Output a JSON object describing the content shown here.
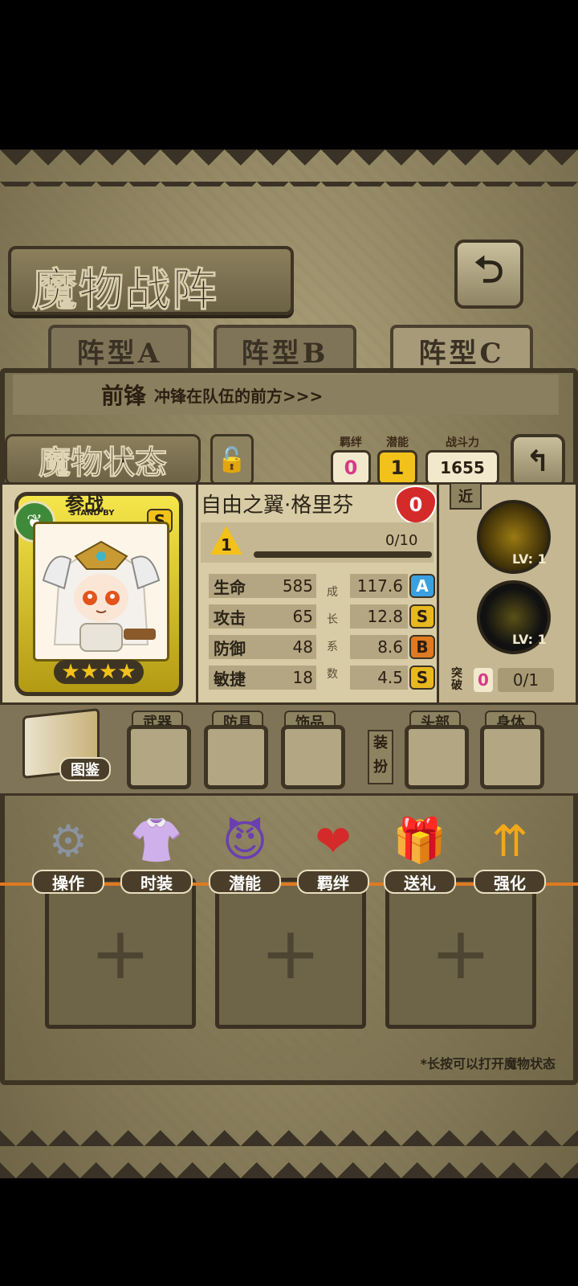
{
  "formation": {
    "title": "魔物战阵",
    "tabs": [
      "阵型A",
      "阵型B",
      "阵型C"
    ],
    "active_tab": 2,
    "role_label": "前锋",
    "role_desc": "冲锋在队伍的前方>>>",
    "hint": "*长按可以打开魔物状态"
  },
  "status": {
    "title": "魔物状态",
    "bond": {
      "label": "羁绊",
      "value": "0"
    },
    "potential": {
      "label": "潜能",
      "value": "1"
    },
    "power": {
      "label": "战斗力",
      "value": "1655"
    },
    "monster_name": "自由之翼·格里芬",
    "heart_count": "0",
    "standby_text": "参战",
    "standby_sub": "STAND BY",
    "rank_letter": "S",
    "stars": "★★★★",
    "level": "1",
    "exp": "0/10",
    "range_tag": "近",
    "stats": [
      {
        "name": "生命",
        "value": "585",
        "growth": "117.6",
        "grade": "A"
      },
      {
        "name": "攻击",
        "value": "65",
        "growth": "12.8",
        "grade": "S"
      },
      {
        "name": "防御",
        "value": "48",
        "growth": "8.6",
        "grade": "B"
      },
      {
        "name": "敏捷",
        "value": "18",
        "growth": "4.5",
        "grade": "S"
      }
    ],
    "growth_label": [
      "成",
      "长",
      "系",
      "数"
    ],
    "skills": [
      {
        "level": "LV: 1"
      },
      {
        "level": "LV: 1"
      }
    ],
    "breakthrough": {
      "label": "突破",
      "value": "0",
      "progress": "0/1"
    },
    "equipment": {
      "weapon": "武器",
      "armor": "防具",
      "accessory": "饰品",
      "outfit_label": "装扮",
      "head": "头部",
      "body": "身体"
    },
    "codex_label": "图鉴",
    "actions": [
      "操作",
      "时装",
      "潜能",
      "羁绊",
      "送礼",
      "强化"
    ]
  },
  "colors": {
    "accent_yellow": "#f2c21a",
    "grade_A": "#3aa0e0",
    "grade_S": "#e8b820",
    "grade_B": "#e07a20",
    "bond_pink": "#d63a8a"
  }
}
